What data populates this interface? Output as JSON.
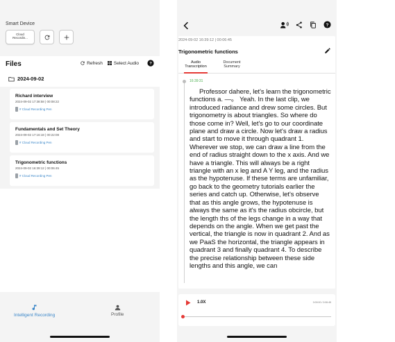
{
  "left": {
    "smart_device_label": "Smart Device",
    "device_card_label": "Cloud Recordin...",
    "files_title": "Files",
    "refresh_label": "Refresh",
    "select_audio_label": "Select Audio",
    "date_folder": "2024-09-02",
    "recordings": [
      {
        "title": "Richard interview",
        "meta": "2024-09-02 17:38:58 | 00:08:22",
        "tag": "# Cloud Recording Pen"
      },
      {
        "title": "Fundamentals and Set Theory",
        "meta": "2024-09-02 17:16:18 | 00:22:08",
        "tag": "# Cloud Recording Pen"
      },
      {
        "title": "Trigonometric functions",
        "meta": "2024-09-02 16:39:12 | 00:06:45",
        "tag": "# Cloud Recording Pen"
      }
    ],
    "tabs": {
      "recording": "Intelligent Recording",
      "profile": "Profile"
    }
  },
  "right": {
    "meta": "2024-09-02 16:39:12 | 00:06:45",
    "title": "Trigonometric functions",
    "tab_audio": "Audio Transcription",
    "tab_doc": "Document Summary",
    "timestamp": "16:39:31",
    "transcript": "Professor dahere, let's learn the trigonometric functions a. —。 Yeah. In the last clip, we introduced radiance and drew some circles. But trigonometry is about triangles. So where do those come in? Well, let's go to our coordinate plane and draw a circle. Now let's draw a radius and start to move it through quadrant 1. Wherever we stop, we can draw a line from the end of radius straight down to the x axis. And we have a triangle. This will always be a right triangle with an x leg and A Y leg, and the radius as the hypotenuse. If these terms are unfamiliar, go back to the geometry tutorials earlier the series and catch up. Otherwise, let's observe that as this angle grows, the hypotenuse is always the same as it's the radius obcircle, but the length ths of the legs change in a way that depends on the angle. When we get past the vertical, the triangle is now in quadrant 2. And as we PaaS the horizontal, the triangle appears in quadrant 3 and finally quadrant 4. To describe the precise relationship between these side lengths and this angle, we can",
    "speed": "1.0X",
    "time": "0:00:00 / 0:06:45",
    "progress": 0
  }
}
